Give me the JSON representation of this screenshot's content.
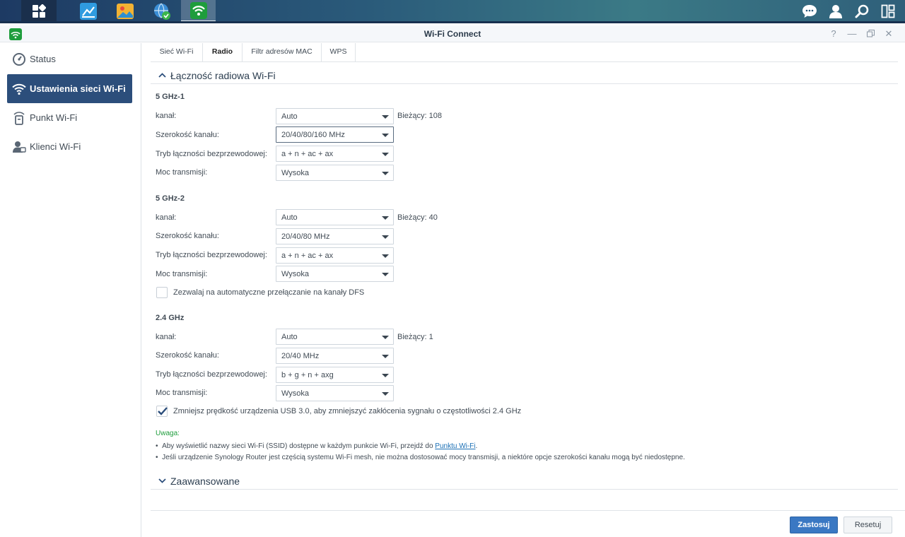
{
  "window": {
    "title": "Wi-Fi Connect"
  },
  "colors": {
    "accent": "#2c4e7b",
    "apply": "#3a78c3",
    "note": "#1e9d3c",
    "link": "#1a6fb5"
  },
  "sidebar": {
    "items": [
      {
        "label": "Status",
        "icon": "status-gauge-icon"
      },
      {
        "label": "Ustawienia sieci Wi-Fi",
        "icon": "wifi-icon",
        "active": true
      },
      {
        "label": "Punkt Wi-Fi",
        "icon": "access-point-icon"
      },
      {
        "label": "Klienci Wi-Fi",
        "icon": "clients-icon"
      }
    ]
  },
  "tabs": [
    {
      "label": "Sieć Wi-Fi"
    },
    {
      "label": "Radio",
      "active": true
    },
    {
      "label": "Filtr adresów MAC"
    },
    {
      "label": "WPS"
    }
  ],
  "radio": {
    "section_title": "Łączność radiowa Wi-Fi",
    "labels": {
      "channel": "kanał:",
      "width": "Szerokość kanału:",
      "mode": "Tryb łączności bezprzewodowej:",
      "power": "Moc transmisji:"
    },
    "band1": {
      "title": "5 GHz-1",
      "channel": "Auto",
      "current": "Bieżący: 108",
      "width": "20/40/80/160 MHz",
      "mode": "a + n + ac + ax",
      "power": "Wysoka"
    },
    "band2": {
      "title": "5 GHz-2",
      "channel": "Auto",
      "current": "Bieżący: 40",
      "width": "20/40/80 MHz",
      "mode": "a + n + ac + ax",
      "power": "Wysoka",
      "dfs_label": "Zezwalaj na automatyczne przełączanie na kanały DFS",
      "dfs_checked": false
    },
    "band3": {
      "title": "2.4 GHz",
      "channel": "Auto",
      "current": "Bieżący: 1",
      "width": "20/40 MHz",
      "mode": "b + g + n + axg",
      "power": "Wysoka",
      "usb_label": "Zmniejsz prędkość urządzenia USB 3.0, aby zmniejszyć zakłócenia sygnału o częstotliwości 2.4 GHz",
      "usb_checked": true
    }
  },
  "note": {
    "heading": "Uwaga:",
    "item1_prefix": "Aby wyświetlić nazwy sieci Wi-Fi (SSID) dostępne w każdym punkcie Wi-Fi, przejdź do ",
    "item1_link": "Punktu Wi-Fi",
    "item1_suffix": ".",
    "item2": "Jeśli urządzenie Synology Router jest częścią systemu Wi-Fi mesh, nie można dostosować mocy transmisji, a niektóre opcje szerokości kanału mogą być niedostępne."
  },
  "advanced": {
    "title": "Zaawansowane"
  },
  "footer": {
    "apply": "Zastosuj",
    "reset": "Resetuj"
  }
}
